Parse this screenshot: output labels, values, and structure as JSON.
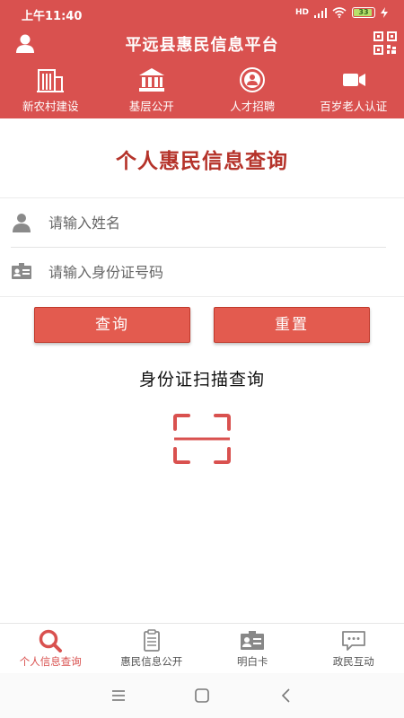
{
  "status_bar": {
    "time": "上午11:40",
    "signal": "HD",
    "battery": "33"
  },
  "header": {
    "title": "平远县惠民信息平台",
    "user_icon": "user-icon",
    "qr_icon": "qr-code-icon"
  },
  "nav": [
    {
      "label": "新农村建设",
      "icon": "building-icon"
    },
    {
      "label": "基层公开",
      "icon": "government-building-icon"
    },
    {
      "label": "人才招聘",
      "icon": "person-circle-icon"
    },
    {
      "label": "百岁老人认证",
      "icon": "video-camera-icon"
    }
  ],
  "page": {
    "title": "个人惠民信息查询"
  },
  "form": {
    "name_placeholder": "请输入姓名",
    "name_value": "",
    "id_placeholder": "请输入身份证号码",
    "id_value": ""
  },
  "buttons": {
    "query": "查询",
    "reset": "重置"
  },
  "scan": {
    "title": "身份证扫描查询"
  },
  "tabs": [
    {
      "label": "个人信息查询",
      "icon": "search-icon",
      "active": true
    },
    {
      "label": "惠民信息公开",
      "icon": "clipboard-icon",
      "active": false
    },
    {
      "label": "明白卡",
      "icon": "id-card-icon",
      "active": false
    },
    {
      "label": "政民互动",
      "icon": "chat-icon",
      "active": false
    }
  ],
  "colors": {
    "brand": "#d9514f",
    "title": "#b5332a",
    "button": "#e35b4f"
  }
}
